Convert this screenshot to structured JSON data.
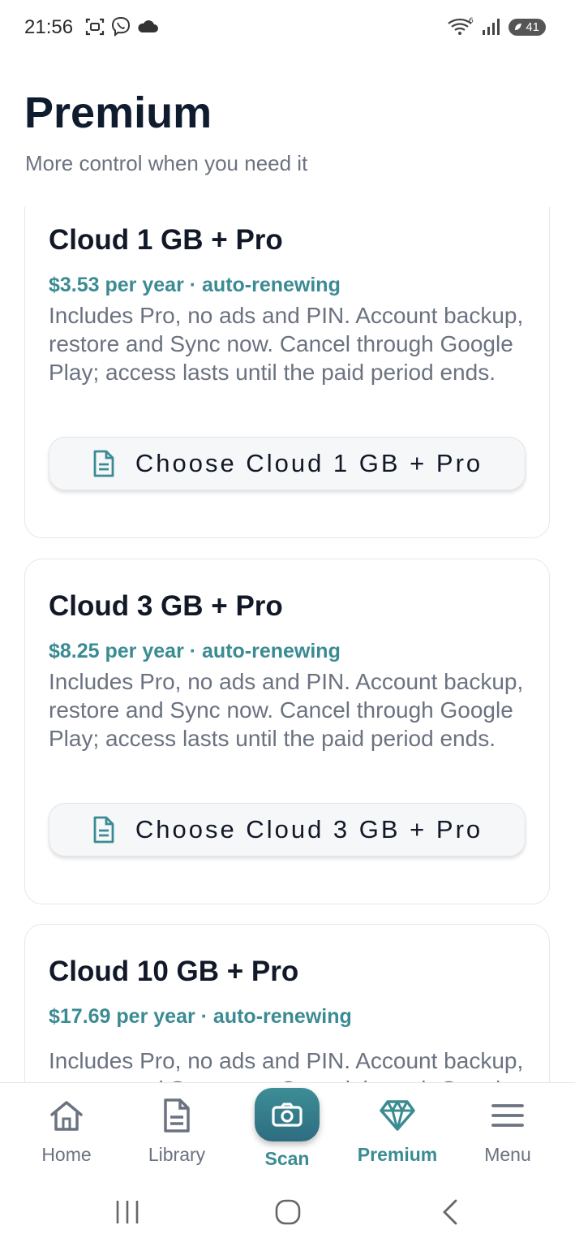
{
  "status_bar": {
    "time": "21:56",
    "battery": "41"
  },
  "header": {
    "title": "Premium",
    "subtitle": "More control when you need it"
  },
  "plans": [
    {
      "title": "Cloud 1 GB + Pro",
      "price": "$3.53 per year · auto-renewing",
      "description": "Includes Pro, no ads and PIN. Account backup, restore and Sync now. Cancel through Google Play; access lasts until the paid period ends.",
      "button_label": "Choose Cloud 1 GB + Pro"
    },
    {
      "title": "Cloud 3 GB + Pro",
      "price": "$8.25 per year · auto-renewing",
      "description": "Includes Pro, no ads and PIN. Account backup, restore and Sync now. Cancel through Google Play; access lasts until the paid period ends.",
      "button_label": "Choose Cloud 3 GB + Pro"
    },
    {
      "title": "Cloud 10 GB + Pro",
      "price": "$17.69 per year · auto-renewing",
      "description": "Includes Pro, no ads and PIN. Account backup, restore and Sync now. Cancel through Google Play; access lasts until the paid period ends."
    }
  ],
  "bottom_nav": {
    "home": "Home",
    "library": "Library",
    "scan": "Scan",
    "premium": "Premium",
    "menu": "Menu"
  },
  "colors": {
    "accent": "#3b8b93",
    "title": "#0f1c2e",
    "muted": "#6b7280"
  }
}
